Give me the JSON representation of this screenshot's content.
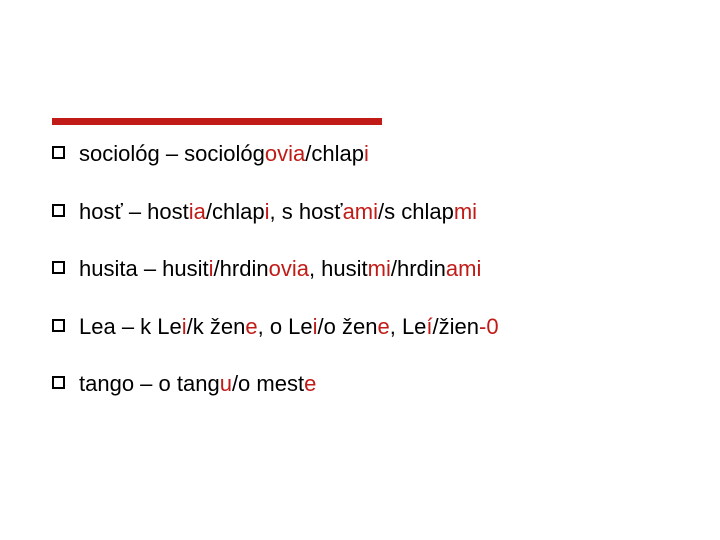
{
  "items": [
    {
      "segments": [
        {
          "t": "sociológ – sociológ",
          "c": "k"
        },
        {
          "t": "ovia",
          "c": "r"
        },
        {
          "t": "/chlap",
          "c": "k"
        },
        {
          "t": "i",
          "c": "r"
        }
      ]
    },
    {
      "segments": [
        {
          "t": "hosť – host",
          "c": "k"
        },
        {
          "t": "ia",
          "c": "r"
        },
        {
          "t": "/chlap",
          "c": "k"
        },
        {
          "t": "i",
          "c": "r"
        },
        {
          "t": ", s hosť",
          "c": "k"
        },
        {
          "t": "ami",
          "c": "r"
        },
        {
          "t": "/s chlap",
          "c": "k"
        },
        {
          "t": "mi",
          "c": "r"
        }
      ]
    },
    {
      "segments": [
        {
          "t": "husita – husit",
          "c": "k"
        },
        {
          "t": "i",
          "c": "r"
        },
        {
          "t": "/hrdin",
          "c": "k"
        },
        {
          "t": "ovia",
          "c": "r"
        },
        {
          "t": ", husit",
          "c": "k"
        },
        {
          "t": "mi",
          "c": "r"
        },
        {
          "t": "/hrdin",
          "c": "k"
        },
        {
          "t": "ami",
          "c": "r"
        }
      ]
    },
    {
      "segments": [
        {
          "t": "Lea – k Le",
          "c": "k"
        },
        {
          "t": "i",
          "c": "r"
        },
        {
          "t": "/k žen",
          "c": "k"
        },
        {
          "t": "e",
          "c": "r"
        },
        {
          "t": ", o Le",
          "c": "k"
        },
        {
          "t": "i",
          "c": "r"
        },
        {
          "t": "/o žen",
          "c": "k"
        },
        {
          "t": "e",
          "c": "r"
        },
        {
          "t": ", Le",
          "c": "k"
        },
        {
          "t": "í",
          "c": "r"
        },
        {
          "t": "/žien",
          "c": "k"
        },
        {
          "t": "-0",
          "c": "r"
        }
      ]
    },
    {
      "segments": [
        {
          "t": "tango – o tang",
          "c": "k"
        },
        {
          "t": "u",
          "c": "r"
        },
        {
          "t": "/o mest",
          "c": "k"
        },
        {
          "t": "e",
          "c": "r"
        }
      ]
    }
  ]
}
